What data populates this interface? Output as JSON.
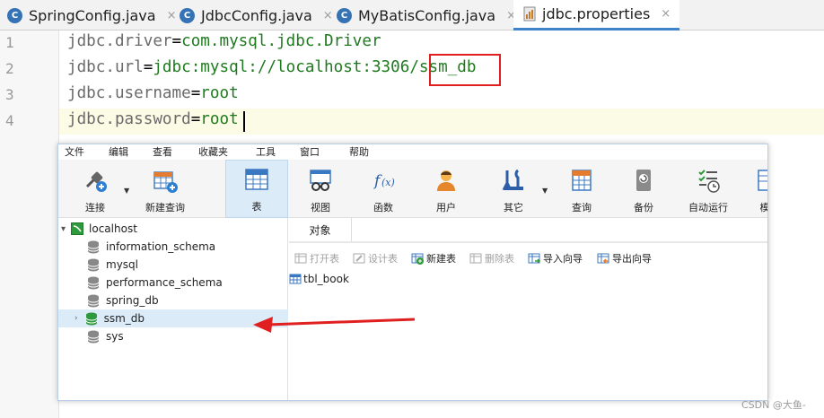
{
  "ide": {
    "tabs": [
      {
        "label": "SpringConfig.java",
        "icon": "java-class-icon"
      },
      {
        "label": "JdbcConfig.java",
        "icon": "java-class-icon"
      },
      {
        "label": "MyBatisConfig.java",
        "icon": "java-class-icon"
      },
      {
        "label": "jdbc.properties",
        "icon": "properties-file-icon",
        "active": true
      }
    ],
    "close_glyph": "×",
    "line_numbers": [
      "1",
      "2",
      "3",
      "4"
    ],
    "lines": [
      {
        "key": "jdbc.driver",
        "eq": "=",
        "value": "com.mysql.jdbc.Driver"
      },
      {
        "key": "jdbc.url",
        "eq": "=",
        "value": "jdbc:mysql://localhost:3306/ssm_db"
      },
      {
        "key": "jdbc.username",
        "eq": "=",
        "value": "root"
      },
      {
        "key": "jdbc.password",
        "eq": "=",
        "value": "root"
      }
    ],
    "highlight_color": "#e02020"
  },
  "navicat": {
    "menu": [
      "文件",
      "编辑",
      "查看",
      "收藏夹",
      "工具",
      "窗口",
      "帮助"
    ],
    "toolbar": [
      {
        "label": "连接",
        "icon": "connect-plug-icon"
      },
      {
        "label": "新建查询",
        "icon": "new-query-icon"
      },
      {
        "label": "表",
        "icon": "table-icon",
        "selected": true
      },
      {
        "label": "视图",
        "icon": "view-glasses-icon"
      },
      {
        "label": "函数",
        "icon": "function-icon"
      },
      {
        "label": "用户",
        "icon": "user-icon"
      },
      {
        "label": "其它",
        "icon": "tools-icon"
      },
      {
        "label": "查询",
        "icon": "query-icon"
      },
      {
        "label": "备份",
        "icon": "backup-icon"
      },
      {
        "label": "自动运行",
        "icon": "schedule-icon"
      },
      {
        "label": "模",
        "icon": "model-icon"
      }
    ],
    "tree": {
      "connection": "localhost",
      "databases": [
        "information_schema",
        "mysql",
        "performance_schema",
        "spring_db",
        "ssm_db",
        "sys"
      ],
      "selected": "ssm_db"
    },
    "object_tab": "对象",
    "object_toolbar": [
      {
        "label": "打开表",
        "disabled": true
      },
      {
        "label": "设计表",
        "disabled": true
      },
      {
        "label": "新建表",
        "disabled": false
      },
      {
        "label": "删除表",
        "disabled": true
      },
      {
        "label": "导入向导",
        "disabled": false
      },
      {
        "label": "导出向导",
        "disabled": false
      }
    ],
    "tables": [
      "tbl_book"
    ]
  },
  "annotation": {
    "arrow_color": "#e02020"
  },
  "watermark": "CSDN @大鱼-"
}
